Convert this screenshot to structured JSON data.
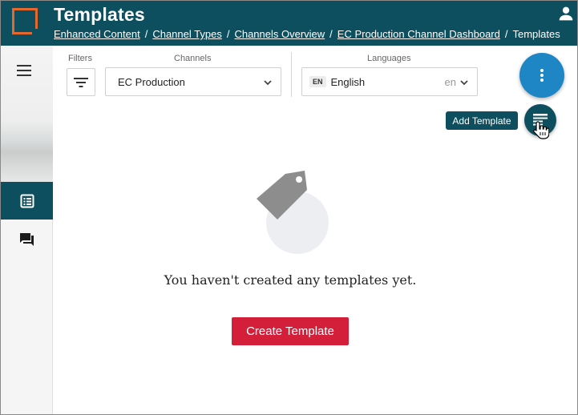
{
  "header": {
    "title": "Templates",
    "breadcrumb": [
      "Enhanced Content",
      "Channel Types",
      "Channels Overview",
      "EC Production Channel Dashboard"
    ],
    "breadcrumb_current": "Templates",
    "separator": "/"
  },
  "filters": {
    "filters_label": "Filters",
    "channels_label": "Channels",
    "channel_value": "EC Production",
    "languages_label": "Languages",
    "language_badge": "EN",
    "language_value": "English",
    "language_code": "en"
  },
  "fab": {
    "tooltip": "Add Template"
  },
  "empty_state": {
    "message": "You haven't created any templates yet.",
    "button": "Create Template"
  },
  "colors": {
    "header_bg": "#0d4f5e",
    "accent_orange": "#e8672c",
    "fab_blue": "#1f86c6",
    "create_red": "#d31f3a"
  },
  "icons": [
    "logo-icon",
    "user-icon",
    "hamburger-menu-icon",
    "list-icon",
    "chat-icon",
    "filter-icon",
    "chevron-down-icon",
    "more-vert-icon",
    "add-template-icon",
    "tag-icon",
    "hand-cursor-icon"
  ]
}
